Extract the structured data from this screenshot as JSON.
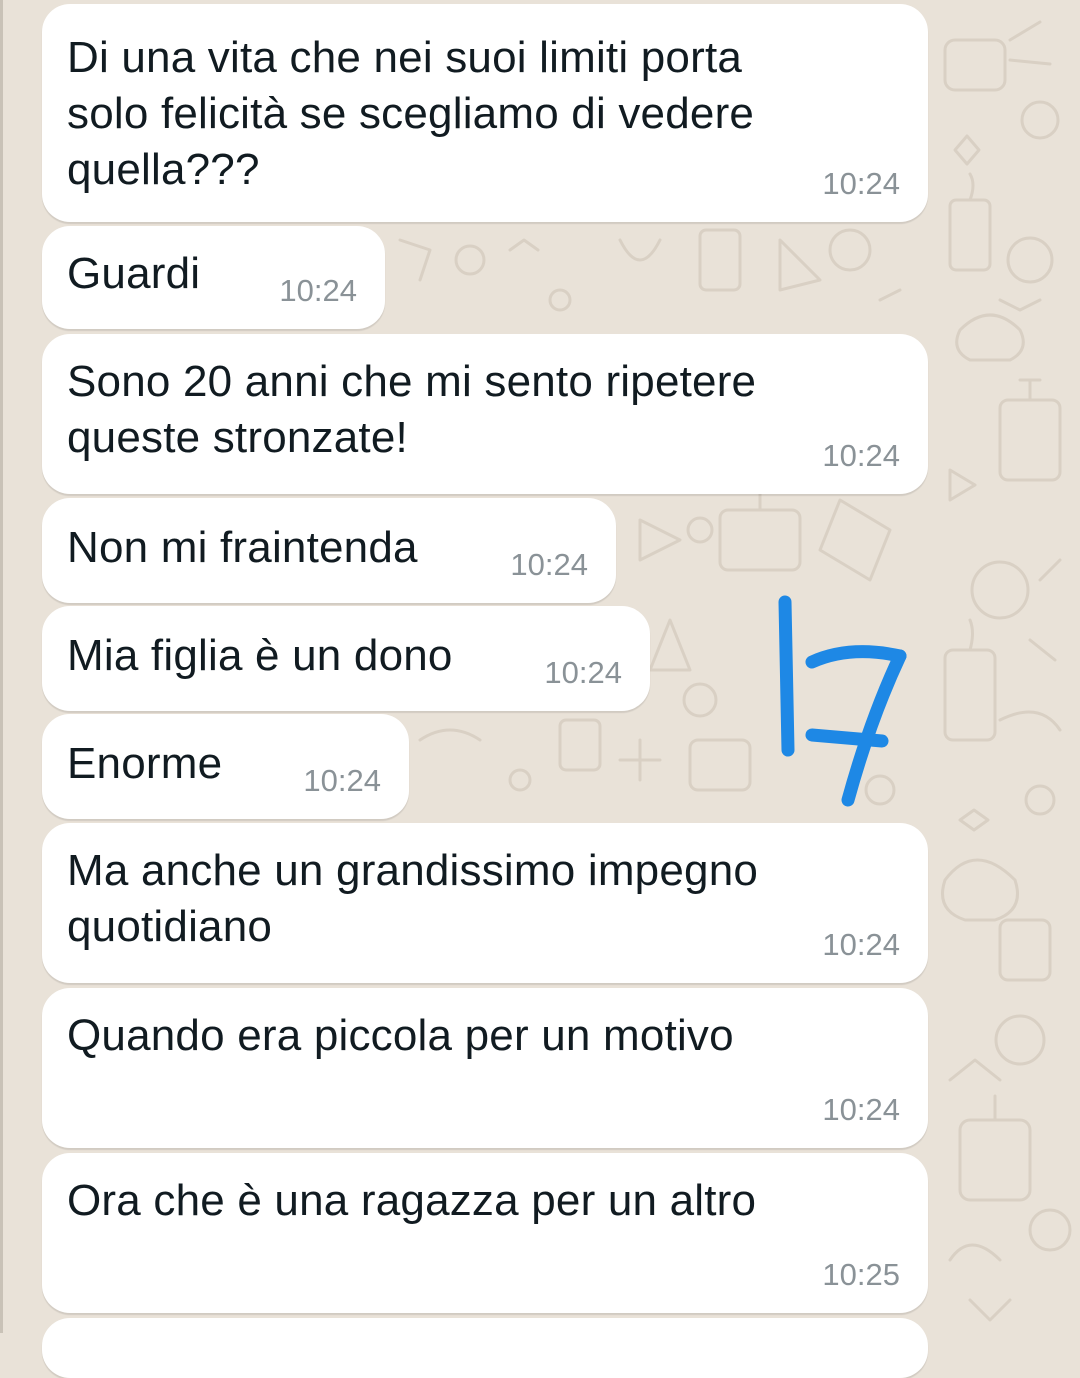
{
  "chat": {
    "messages": [
      {
        "text": "Di una vita che nei suoi limiti porta\nsolo felicità se scegliamo di vedere\nquella???",
        "time": "10:24"
      },
      {
        "text": "Guardi",
        "time": "10:24"
      },
      {
        "text": "Sono 20 anni che mi sento ripetere\nqueste stronzate!",
        "time": "10:24"
      },
      {
        "text": "Non mi fraintenda",
        "time": "10:24"
      },
      {
        "text": "Mia figlia è un dono",
        "time": "10:24"
      },
      {
        "text": "Enorme",
        "time": "10:24"
      },
      {
        "text": "Ma anche un grandissimo impegno\nquotidiano",
        "time": "10:24"
      },
      {
        "text": "Quando era piccola per un motivo",
        "time": "10:24"
      },
      {
        "text": "Ora che è una ragazza per un altro",
        "time": "10:25"
      }
    ]
  },
  "annotation": {
    "text": "17",
    "color": "#1e88e5"
  },
  "colors": {
    "wallpaper": "#e9e2d8",
    "bubble": "#ffffff",
    "text": "#111b21",
    "time": "#8a9297"
  }
}
